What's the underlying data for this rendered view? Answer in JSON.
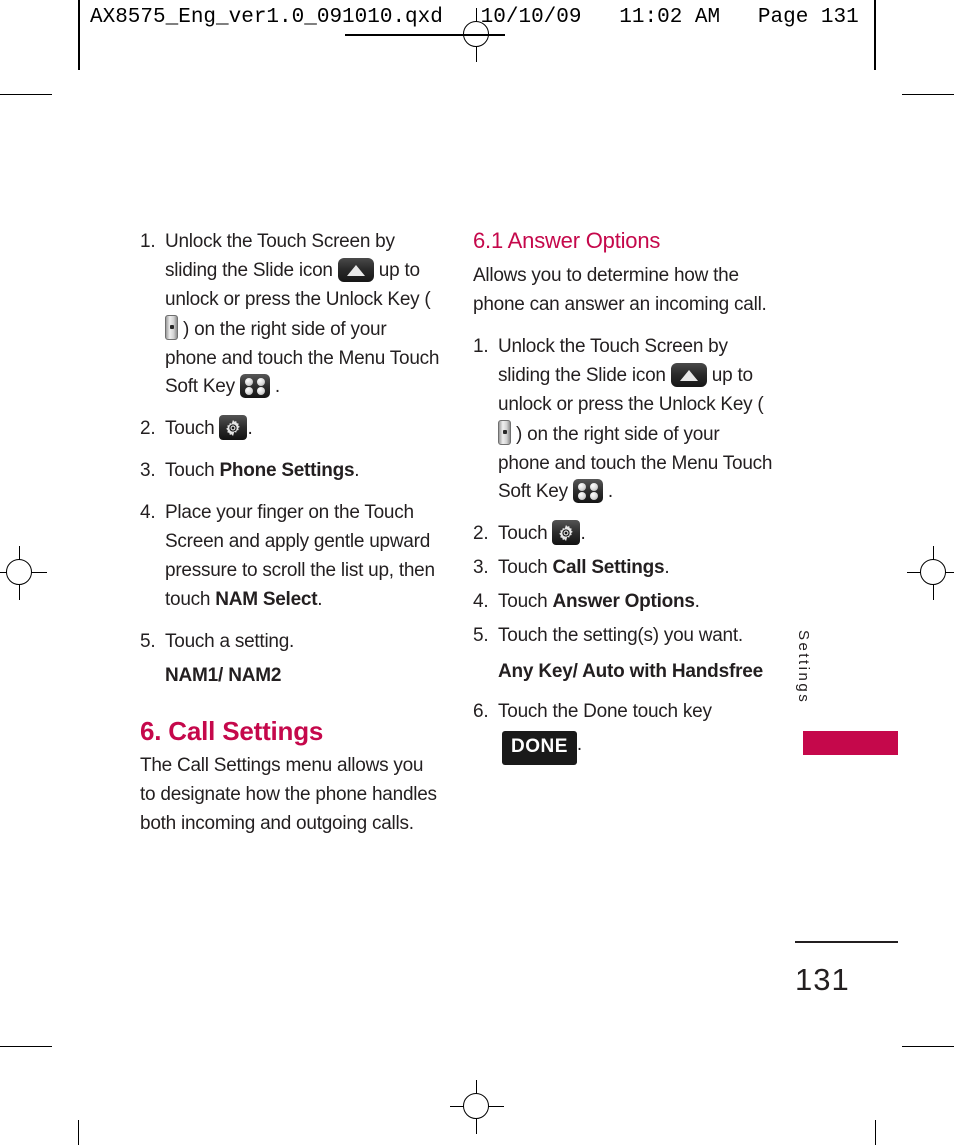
{
  "slug": {
    "text": "AX8575_Eng_ver1.0_091010.qxd   10/10/09   11:02 AM   Page 131"
  },
  "left_column": {
    "steps": [
      {
        "num": "1.",
        "text_parts": [
          "Unlock the Touch Screen by sliding the Slide icon ",
          " up to unlock or press the Unlock Key ( ",
          " ) on the right side of your phone and touch the Menu Touch Soft Key ",
          " ."
        ]
      },
      {
        "num": "2.",
        "text": "Touch ",
        "after": "."
      },
      {
        "num": "3.",
        "text": "Touch ",
        "bold": "Phone Settings",
        "after": "."
      },
      {
        "num": "4.",
        "text": "Place your finger on the Touch Screen and apply gentle upward pressure to scroll the list up, then touch ",
        "bold": "NAM Select",
        "after": "."
      },
      {
        "num": "5.",
        "text": "Touch a setting."
      }
    ],
    "option_values": "NAM1/ NAM2",
    "section_heading": "6. Call Settings",
    "section_body": "The Call Settings menu allows you to designate how the phone handles both incoming and outgoing calls."
  },
  "right_column": {
    "section_heading": "6.1 Answer Options",
    "section_body": "Allows you to determine how the phone can answer an incoming call.",
    "steps": [
      {
        "num": "1.",
        "text_parts": [
          "Unlock the Touch Screen by sliding the Slide icon ",
          " up to unlock or press the Unlock Key ( ",
          " ) on the right side of your phone and touch the Menu Touch Soft Key ",
          " ."
        ]
      },
      {
        "num": "2.",
        "text": "Touch ",
        "after": "."
      },
      {
        "num": "3.",
        "text": "Touch ",
        "bold": "Call Settings",
        "after": "."
      },
      {
        "num": "4.",
        "text": "Touch ",
        "bold": "Answer Options",
        "after": "."
      },
      {
        "num": "5.",
        "text": "Touch the setting(s) you want."
      },
      {
        "num": "6.",
        "text": "Touch the Done touch key ",
        "after": "."
      }
    ],
    "option_values": "Any Key/ Auto with Handsfree",
    "done_key_label": "DONE"
  },
  "side_tab": {
    "label": "Settings"
  },
  "folio": {
    "page_number": "131"
  },
  "icons": {
    "slide": "slide-up-icon",
    "unlock_key": "unlock-key-icon",
    "menu_soft_key": "menu-soft-key-icon",
    "settings_gear": "settings-gear-icon",
    "done_key": "done-touch-key"
  },
  "colors": {
    "accent": "#c5084b",
    "text": "#231f20",
    "icon_tile": "#1a1a1a"
  }
}
